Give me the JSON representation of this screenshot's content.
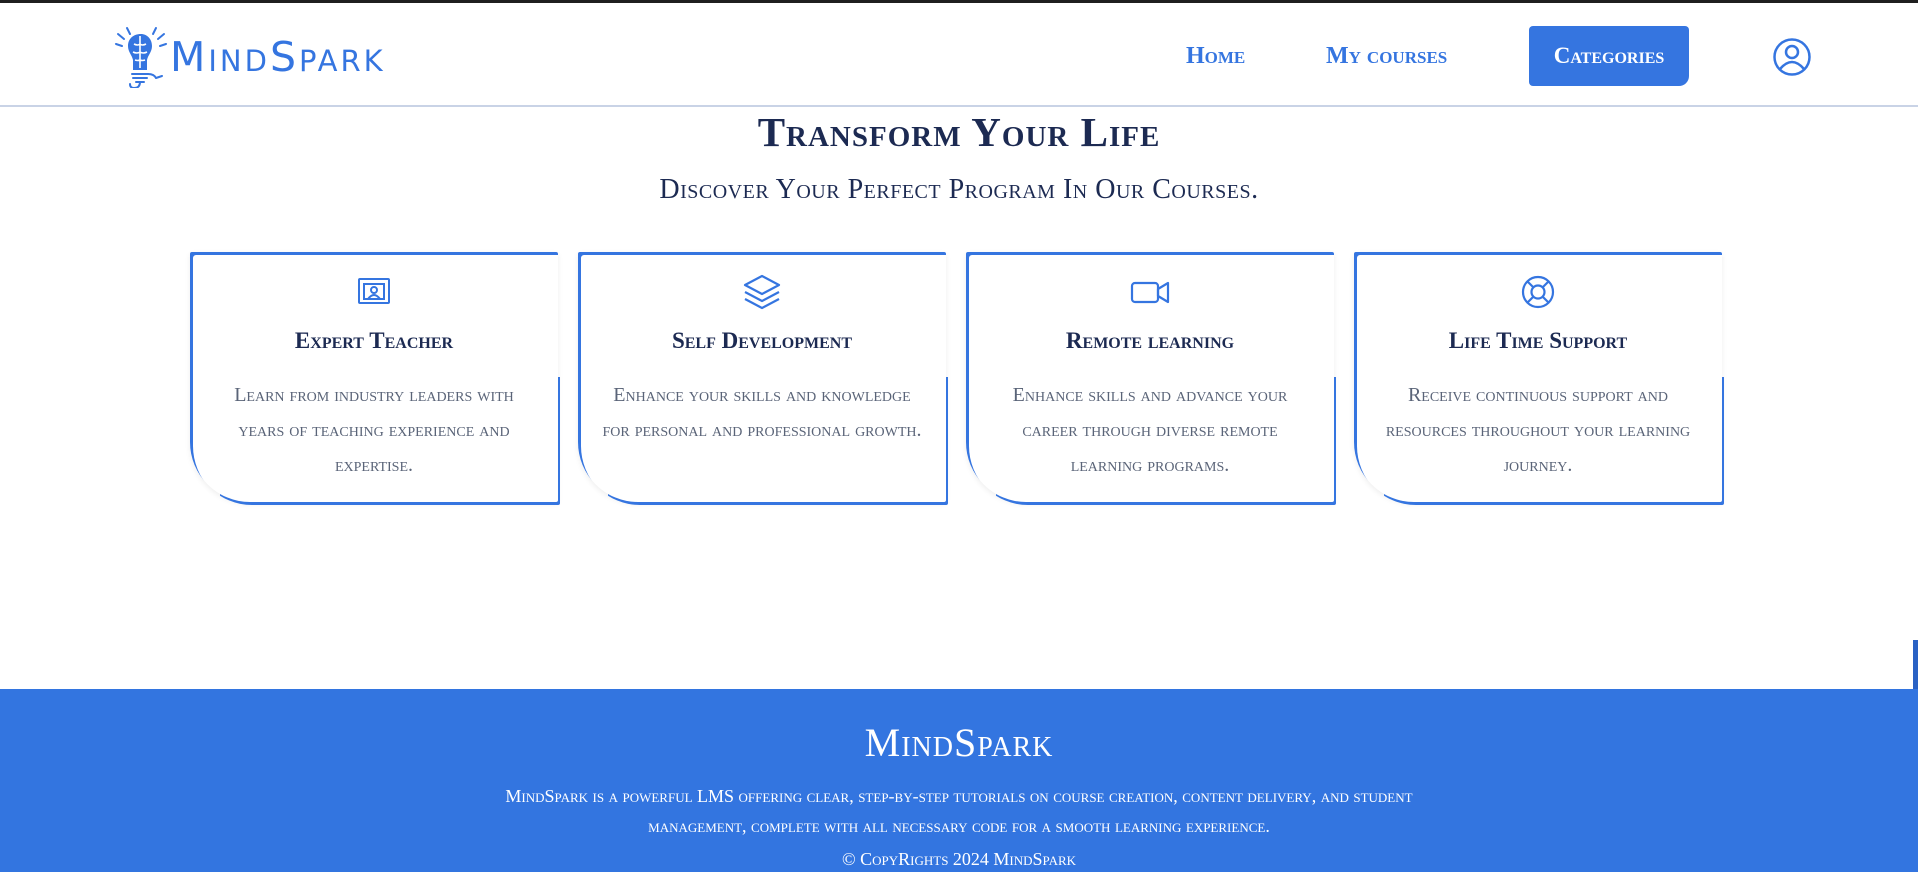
{
  "brand": {
    "name": "MindSpark",
    "color": "#3575e0"
  },
  "nav": {
    "home": "Home",
    "my_courses": "My courses",
    "categories": "Categories"
  },
  "icons": {
    "logo": "brain-bulb-icon",
    "profile": "user-circle-icon"
  },
  "hero": {
    "title": "Transform Your Life",
    "subtitle": "Discover Your Perfect Program In Our Courses."
  },
  "features": [
    {
      "icon": "presentation-icon",
      "title": "Expert Teacher",
      "text": "Learn from industry leaders with years of teaching experience and expertise."
    },
    {
      "icon": "layers-icon",
      "title": "Self Development",
      "text": "Enhance your skills and knowledge for personal and professional growth."
    },
    {
      "icon": "video-camera-icon",
      "title": "Remote learning",
      "text": "Enhance skills and advance your career through diverse remote learning programs."
    },
    {
      "icon": "lifebuoy-icon",
      "title": "Life Time Support",
      "text": "Receive continuous support and resources throughout your learning journey."
    }
  ],
  "footer": {
    "title": "MindSpark",
    "description": "MindSpark is a powerful LMS offering clear, step-by-step tutorials on course creation, content delivery, and student management, complete with all necessary code for a smooth learning experience.",
    "copyright": "© CopyRights 2024 MindSpark"
  }
}
